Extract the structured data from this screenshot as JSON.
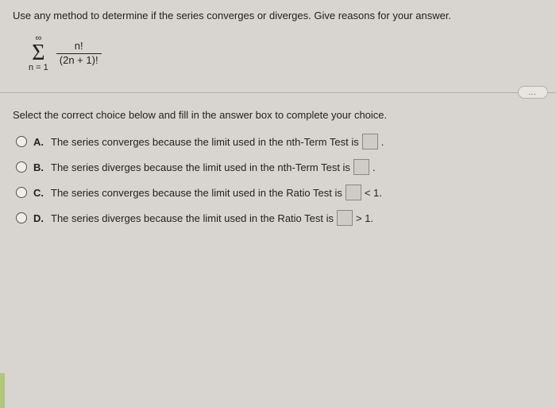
{
  "question": "Use any method to determine if the series converges or diverges. Give reasons for your answer.",
  "series": {
    "upper": "∞",
    "symbol": "Σ",
    "lower": "n = 1",
    "numerator": "n!",
    "denominator": "(2n + 1)!"
  },
  "ellipsis": "…",
  "instruction": "Select the correct choice below and fill in the answer box to complete your choice.",
  "choices": {
    "A": {
      "label": "A.",
      "pre": "The series converges because the limit used in the nth-Term Test is",
      "post": "."
    },
    "B": {
      "label": "B.",
      "pre": "The series diverges because the limit used in the nth-Term Test is",
      "post": "."
    },
    "C": {
      "label": "C.",
      "pre": "The series converges because the limit used in the Ratio Test is",
      "post": "< 1."
    },
    "D": {
      "label": "D.",
      "pre": "The series diverges because the limit used in the Ratio Test is",
      "post": "> 1."
    }
  }
}
